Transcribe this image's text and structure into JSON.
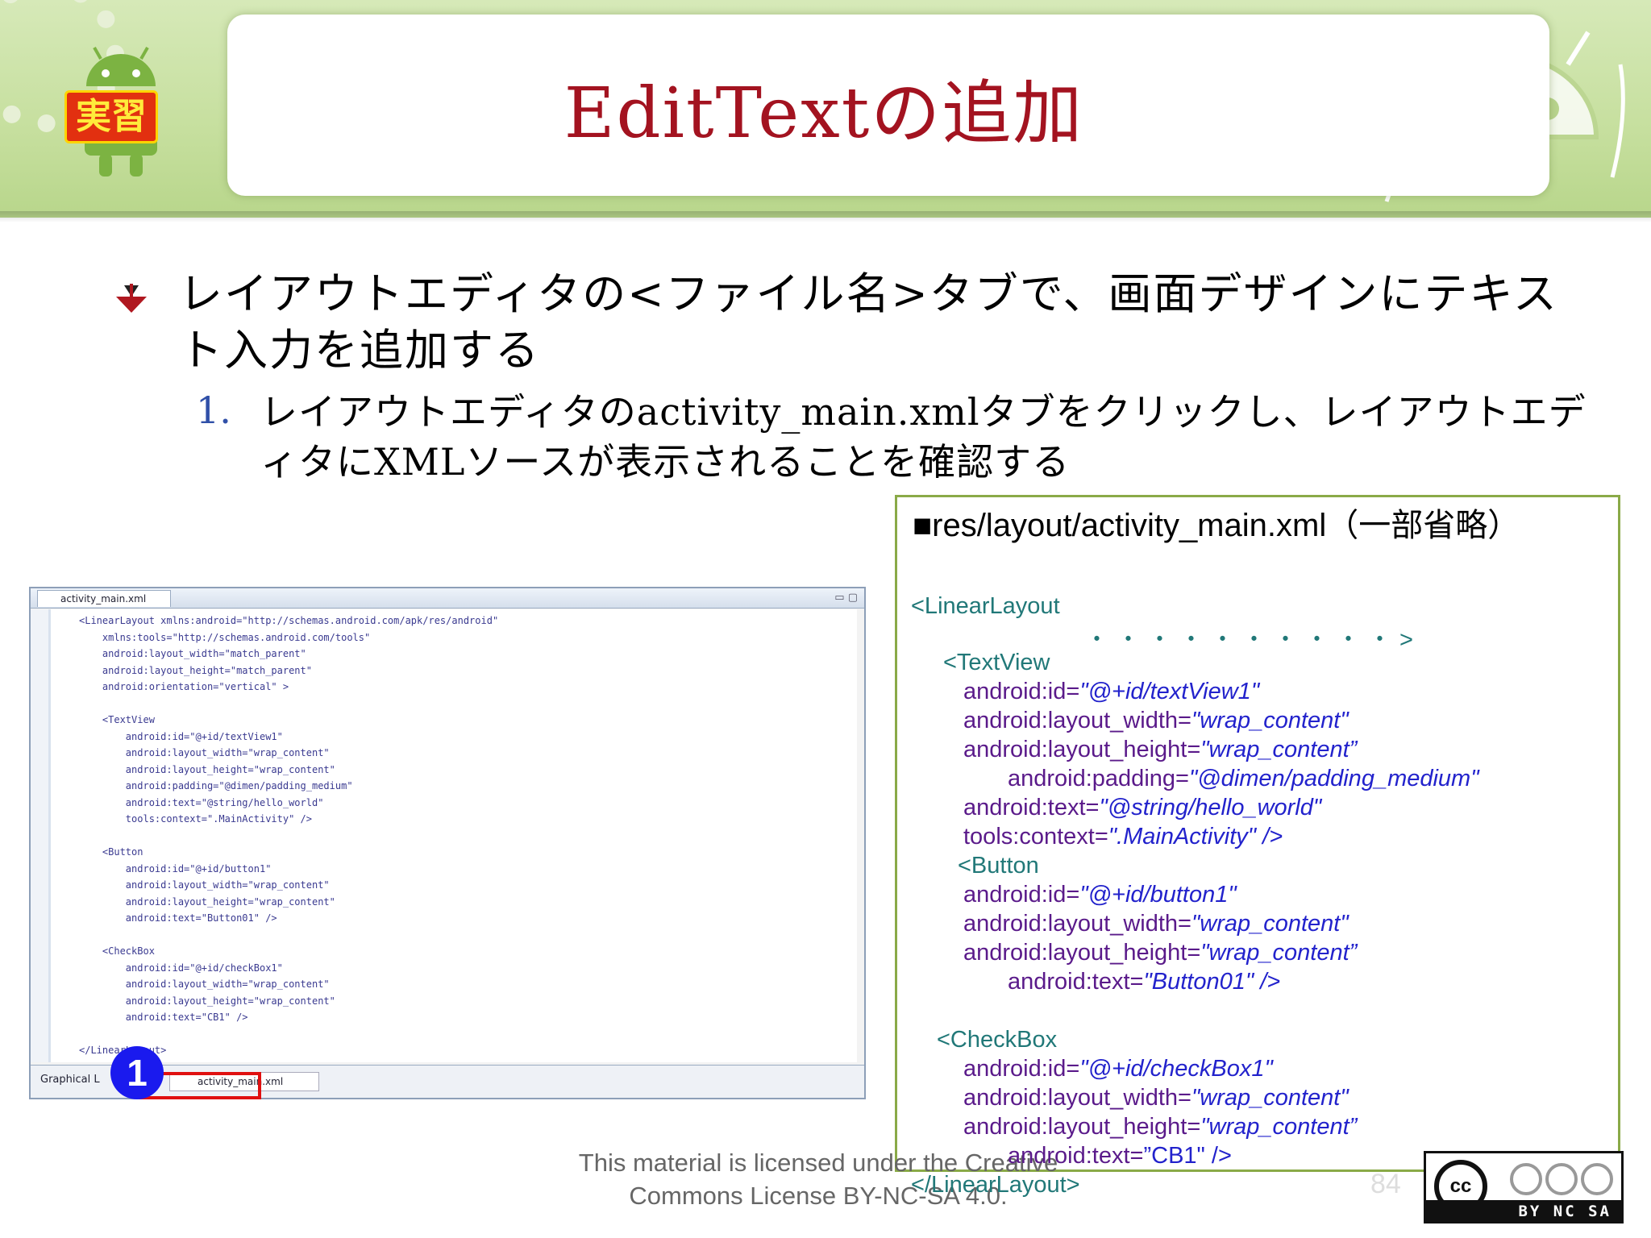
{
  "slide": {
    "title": "EditTextの追加",
    "badge": "実習",
    "bullet1": "レイアウトエディタの<ファイル名>タブで、画面デザインにテキスト入力を追加する",
    "step_number": "1.",
    "step1": "レイアウトエディタのactivity_main.xmlタブをクリックし、レイアウトエディタにXMLソースが表示されることを確認する"
  },
  "screenshot": {
    "tab_title": "activity_main.xml",
    "bottom_tab_graphical": "Graphical L",
    "bottom_tab_xml": "activity_main.xml",
    "callout_number": "1",
    "code_lines": [
      "<LinearLayout xmlns:android=\"http://schemas.android.com/apk/res/android\"",
      "    xmlns:tools=\"http://schemas.android.com/tools\"",
      "    android:layout_width=\"match_parent\"",
      "    android:layout_height=\"match_parent\"",
      "    android:orientation=\"vertical\" >",
      "",
      "    <TextView",
      "        android:id=\"@+id/textView1\"",
      "        android:layout_width=\"wrap_content\"",
      "        android:layout_height=\"wrap_content\"",
      "        android:padding=\"@dimen/padding_medium\"",
      "        android:text=\"@string/hello_world\"",
      "        tools:context=\".MainActivity\" />",
      "",
      "    <Button",
      "        android:id=\"@+id/button1\"",
      "        android:layout_width=\"wrap_content\"",
      "        android:layout_height=\"wrap_content\"",
      "        android:text=\"Button01\" />",
      "",
      "    <CheckBox",
      "        android:id=\"@+id/checkBox1\"",
      "        android:layout_width=\"wrap_content\"",
      "        android:layout_height=\"wrap_content\"",
      "        android:text=\"CB1\" />",
      "",
      "</LinearLayout>"
    ]
  },
  "xml_panel": {
    "title": "■res/layout/activity_main.xml（一部省略）",
    "linear_open": "<LinearLayout",
    "dots": "・・・・・・・・・・>",
    "textview_open": "<TextView",
    "tv_id_attr": "android:id=",
    "tv_id_val": "\"@+id/textView1\"",
    "tv_w_attr": "android:layout_width=",
    "tv_w_val": "\"wrap_content\"",
    "tv_h_attr": "android:layout_height=",
    "tv_h_val": "\"wrap_content”",
    "tv_pad_attr": "android:padding=",
    "tv_pad_val": "\"@dimen/padding_medium\"",
    "tv_text_attr": "android:text=",
    "tv_text_val": "\"@string/hello_world\"",
    "tv_ctx_attr": "tools:context=",
    "tv_ctx_val": "\".MainActivity\" />",
    "button_open": "<Button",
    "b_id_attr": "android:id=",
    "b_id_val": "\"@+id/button1\"",
    "b_w_attr": "android:layout_width=",
    "b_w_val": "\"wrap_content\"",
    "b_h_attr": "android:layout_height=",
    "b_h_val": "\"wrap_content”",
    "b_text_attr": "android:text=",
    "b_text_val": "\"Button01\" />",
    "checkbox_open": "<CheckBox",
    "c_id_attr": "android:id=",
    "c_id_val": "\"@+id/checkBox1\"",
    "c_w_attr": "android:layout_width=",
    "c_w_val": "\"wrap_content\"",
    "c_h_attr": "android:layout_height=",
    "c_h_val": "\"wrap_content”",
    "c_text_attr": "android:text=",
    "c_text_val": "”CB1\" />",
    "linear_close": "</LinearLayout>"
  },
  "footer": {
    "license_line1": "This material is licensed under the Creative",
    "license_line2": "Commons License BY-NC-SA 4.0.",
    "page_number": "84",
    "cc_label": "BY NC SA",
    "cc_logo": "cc"
  }
}
